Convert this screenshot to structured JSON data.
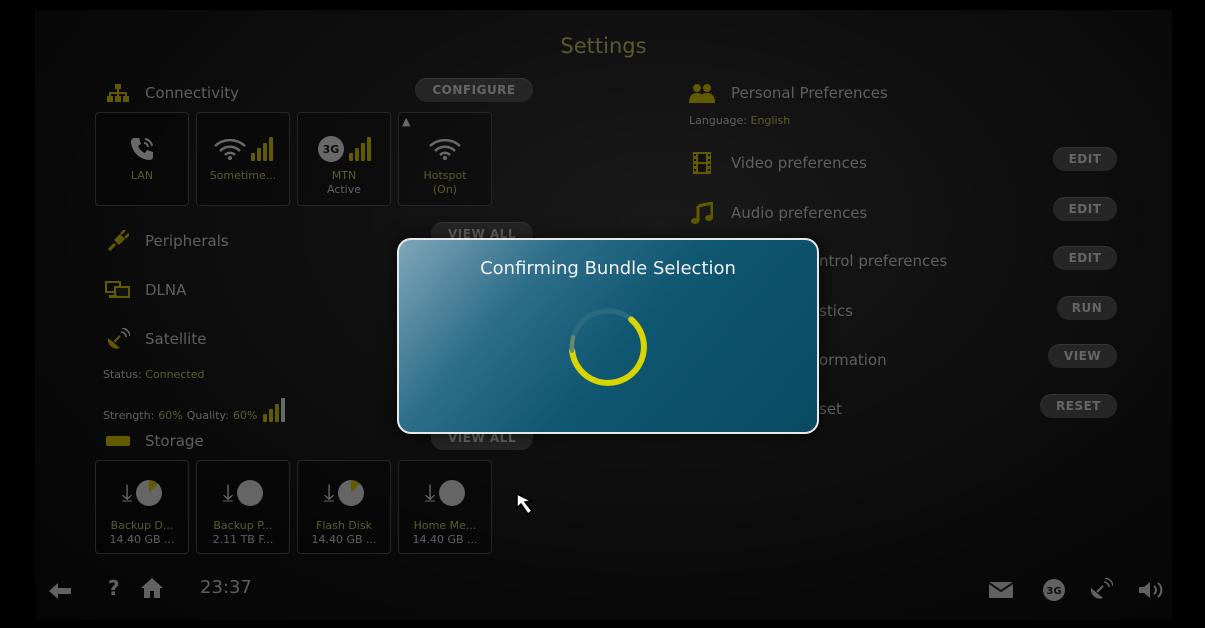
{
  "header": {
    "title": "Settings"
  },
  "connectivity": {
    "title": "Connectivity",
    "icon": "network-icon",
    "configure_label": "CONFIGURE",
    "tiles": [
      {
        "name": "lan",
        "icon": "phone-icon",
        "label": "LAN",
        "sub": ""
      },
      {
        "name": "wifi",
        "icon": "wifi-lock-icon",
        "label": "Sometime...",
        "sub": ""
      },
      {
        "name": "mtn",
        "icon": "3g-icon",
        "label": "MTN",
        "sub": "Active"
      },
      {
        "name": "hotspot",
        "icon": "wifi-icon",
        "label": "Hotspot",
        "sub": "(On)"
      }
    ]
  },
  "peripherals": {
    "title": "Peripherals",
    "icon": "plug-icon",
    "view_all_label": "VIEW ALL"
  },
  "dlna": {
    "title": "DLNA",
    "icon": "dlna-devices-icon"
  },
  "satellite": {
    "title": "Satellite",
    "icon": "satellite-dish-icon",
    "status_label": "Status:",
    "status_value": "Connected",
    "strength_label": "Strength:",
    "strength_value": "60%",
    "quality_label": "Quality:",
    "quality_value": "60%"
  },
  "storage": {
    "title": "Storage",
    "icon": "drive-icon",
    "view_all_label": "VIEW ALL",
    "tiles": [
      {
        "label": "Backup D...",
        "size": "14.40 GB ..."
      },
      {
        "label": "Backup P...",
        "size": "2.11 TB F..."
      },
      {
        "label": "Flash Disk",
        "size": "14.40 GB ..."
      },
      {
        "label": "Home Me...",
        "size": "14.40 GB ..."
      }
    ]
  },
  "preferences": {
    "title": "Personal Preferences",
    "icon": "users-icon",
    "language_label": "Language:",
    "language_value": "English",
    "items": [
      {
        "label": "Video preferences",
        "button": "EDIT",
        "icon": "film-icon"
      },
      {
        "label": "Audio preferences",
        "button": "EDIT",
        "icon": "music-note-icon"
      },
      {
        "label": "ntrol preferences",
        "button": "EDIT",
        "icon": "remote-icon"
      },
      {
        "label": "stics",
        "button": "RUN",
        "icon": "diagnostics-icon"
      },
      {
        "label": "ormation",
        "button": "VIEW",
        "icon": "info-icon"
      },
      {
        "label": "set",
        "button": "RESET",
        "icon": "reset-icon"
      }
    ]
  },
  "modal": {
    "title": "Confirming Bundle Selection"
  },
  "footer": {
    "time": "23:37",
    "help": "?"
  },
  "colors": {
    "accent": "#d8c800",
    "modal_bg": "#0f5670",
    "label_yellow": "#c6c46a"
  }
}
